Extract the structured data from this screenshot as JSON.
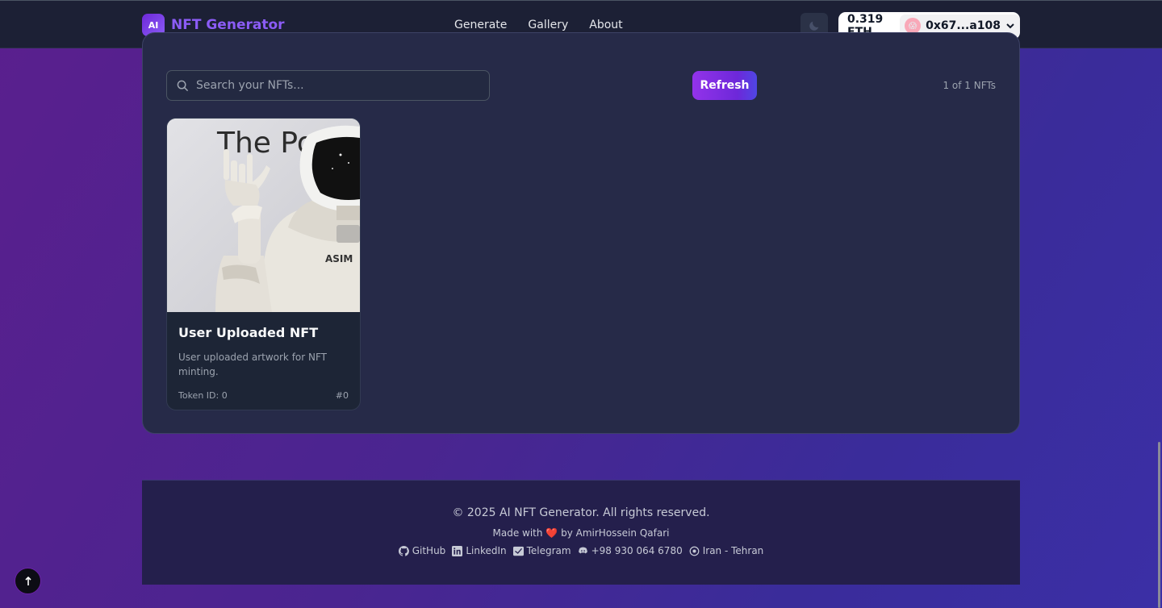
{
  "header": {
    "logo_badge": "AI",
    "logo_text": "NFT Generator",
    "nav": [
      "Generate",
      "Gallery",
      "About"
    ],
    "wallet": {
      "balance": "0.319 ETH",
      "address": "0x67...a108"
    }
  },
  "gallery": {
    "search_placeholder": "Search your NFTs...",
    "refresh_label": "Refresh",
    "count_text": "1 of 1 NFTs",
    "cards": [
      {
        "title": "User Uploaded NFT",
        "description": "User uploaded artwork for NFT minting.",
        "token_id": "Token ID: 0",
        "number": "#0",
        "image_text": "The Po",
        "robot_text": "ASIM"
      }
    ]
  },
  "footer": {
    "copyright": "© 2025 AI NFT Generator. All rights reserved.",
    "made_prefix": "Made with",
    "made_suffix": "by AmirHossein Qafari",
    "links": [
      "GitHub",
      "LinkedIn",
      "Telegram",
      "+98 930 064 6780",
      "Iran - Tehran"
    ]
  },
  "colors": {
    "accent": "#8b5cf6",
    "panel": "#262a48",
    "topbar": "#1c2035"
  },
  "icons": [
    "moon-icon",
    "search-icon",
    "github-icon",
    "linkedin-icon",
    "telegram-icon",
    "discord-icon",
    "location-icon",
    "arrow-up-icon"
  ]
}
